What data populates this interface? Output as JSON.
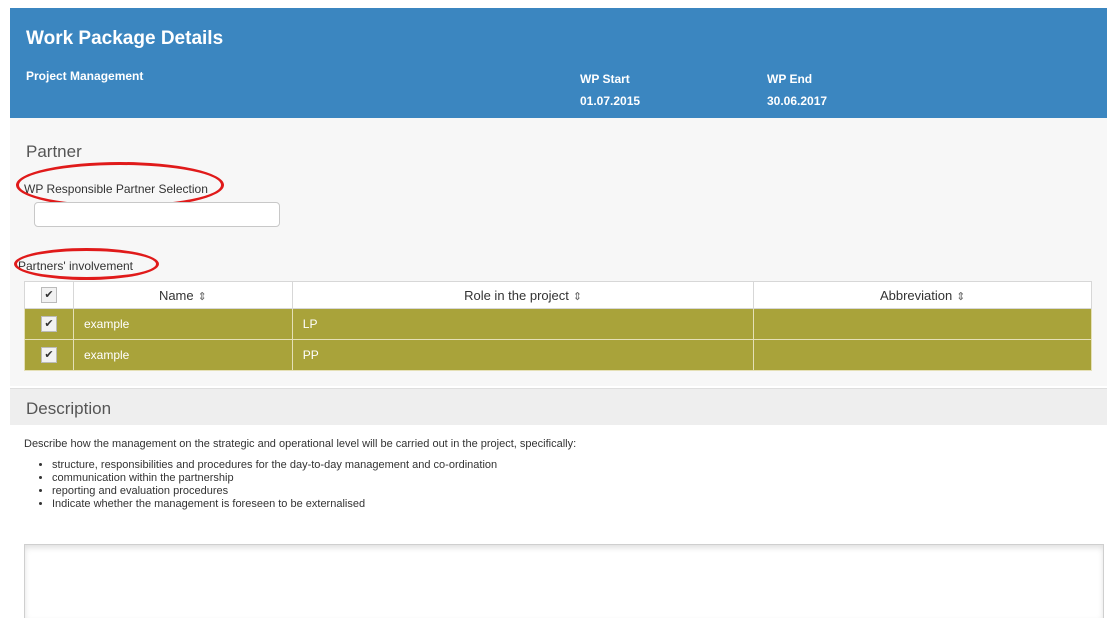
{
  "header": {
    "title": "Work Package Details",
    "subtitle": "Project Management",
    "wp_start_label": "WP Start",
    "wp_start_value": "01.07.2015",
    "wp_end_label": "WP End",
    "wp_end_value": "30.06.2017",
    "background_color": "#3b86c0"
  },
  "partner": {
    "section_title": "Partner",
    "responsible_label": "WP Responsible Partner Selection",
    "responsible_value": "",
    "involvement_label": "Partners' involvement",
    "table": {
      "columns": [
        "Name",
        "Role in the project",
        "Abbreviation"
      ],
      "sort_icon": "⇕",
      "rows": [
        {
          "checked": true,
          "name": "example",
          "role": "LP",
          "abbreviation": ""
        },
        {
          "checked": true,
          "name": "example",
          "role": "PP",
          "abbreviation": ""
        }
      ],
      "row_color": "#a9a33a"
    },
    "highlight_color": "#e01a1a"
  },
  "description": {
    "section_title": "Description",
    "intro": "Describe how the management on the strategic and operational level will be carried out in the project, specifically:",
    "bullets": [
      "structure, responsibilities and procedures for the day-to-day management and co-ordination",
      "communication within the partnership",
      "reporting and evaluation procedures",
      "Indicate whether the management is foreseen to be externalised"
    ],
    "editor_value": ""
  }
}
